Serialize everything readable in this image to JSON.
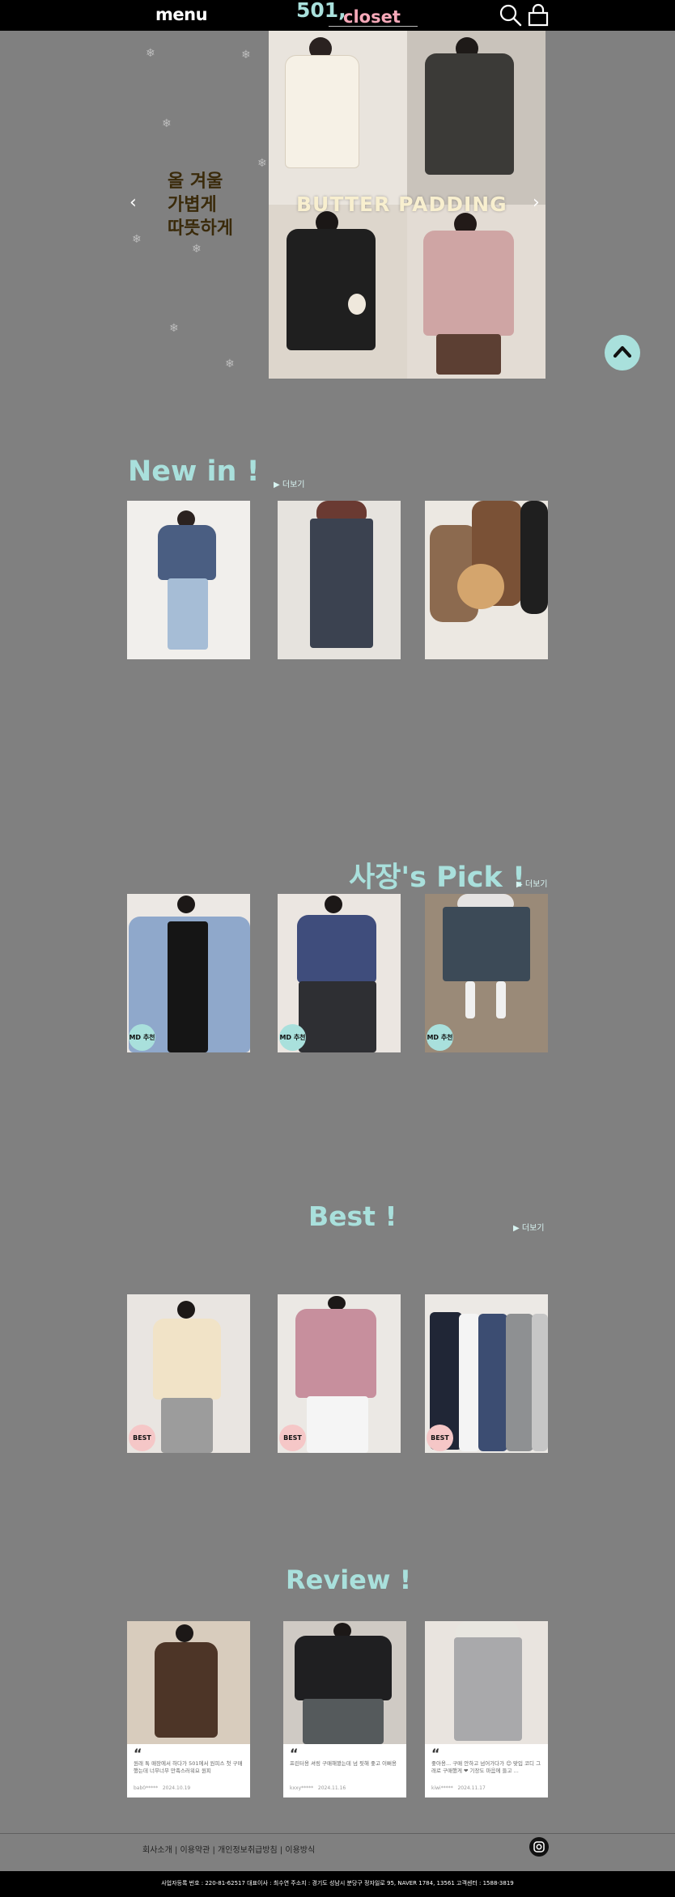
{
  "header": {
    "menu_label": "menu",
    "logo_number": "501,",
    "logo_name": "closet"
  },
  "hero": {
    "caption": [
      "올 겨울",
      "가볍게",
      "따뜻하게"
    ],
    "title": "BUTTER PADDING"
  },
  "sections": {
    "new_in": {
      "title": "New in !",
      "more": "▶ 더보기"
    },
    "pick": {
      "title": "사장's Pick !",
      "more": "▶ 더보기",
      "badge": "MD 추천"
    },
    "best": {
      "title": "Best !",
      "more": "▶ 더보기",
      "badge": "BEST"
    },
    "review": {
      "title": "Review !"
    }
  },
  "reviews": [
    {
      "quote": "“",
      "text": "원래 톡 매장에서 하다가 501에서 원피스 첫 구매했는데 너무너무 만족스러워요 원피",
      "user": "bab0*****",
      "date": "2024.10.19"
    },
    {
      "quote": "“",
      "text": "프린터용 셔링 구매해봤는데 넘 핏해 좋고 이뻐용",
      "user": "kxxy*****",
      "date": "2024.11.16"
    },
    {
      "quote": "“",
      "text": "좋아용... 구매 안하고 넘어가다가 😊 맞입 코디 그래로 구매했게 ❤ 기장도 마음에 들고 ...",
      "user": "kiwi*****",
      "date": "2024.11.17"
    }
  ],
  "footer": {
    "links": "회사소개 | 이용약관 | 개인정보취급방침 | 이용방식",
    "business_info": "사업자등록 번호 : 220-81-62517   대표이사 : 최수연   주소지 : 경기도 성남시 분당구 정자일로 95, NAVER 1784, 13561   고객센터 : 1588-3819"
  },
  "colors": {
    "background": "#808080",
    "accent_mint": "#a9e0dc",
    "accent_pink": "#f7a9b9",
    "header_bg": "#000000"
  },
  "icons": [
    "search-icon",
    "bag-icon",
    "chevron-left-icon",
    "chevron-right-icon",
    "arrow-up-icon",
    "instagram-icon"
  ]
}
